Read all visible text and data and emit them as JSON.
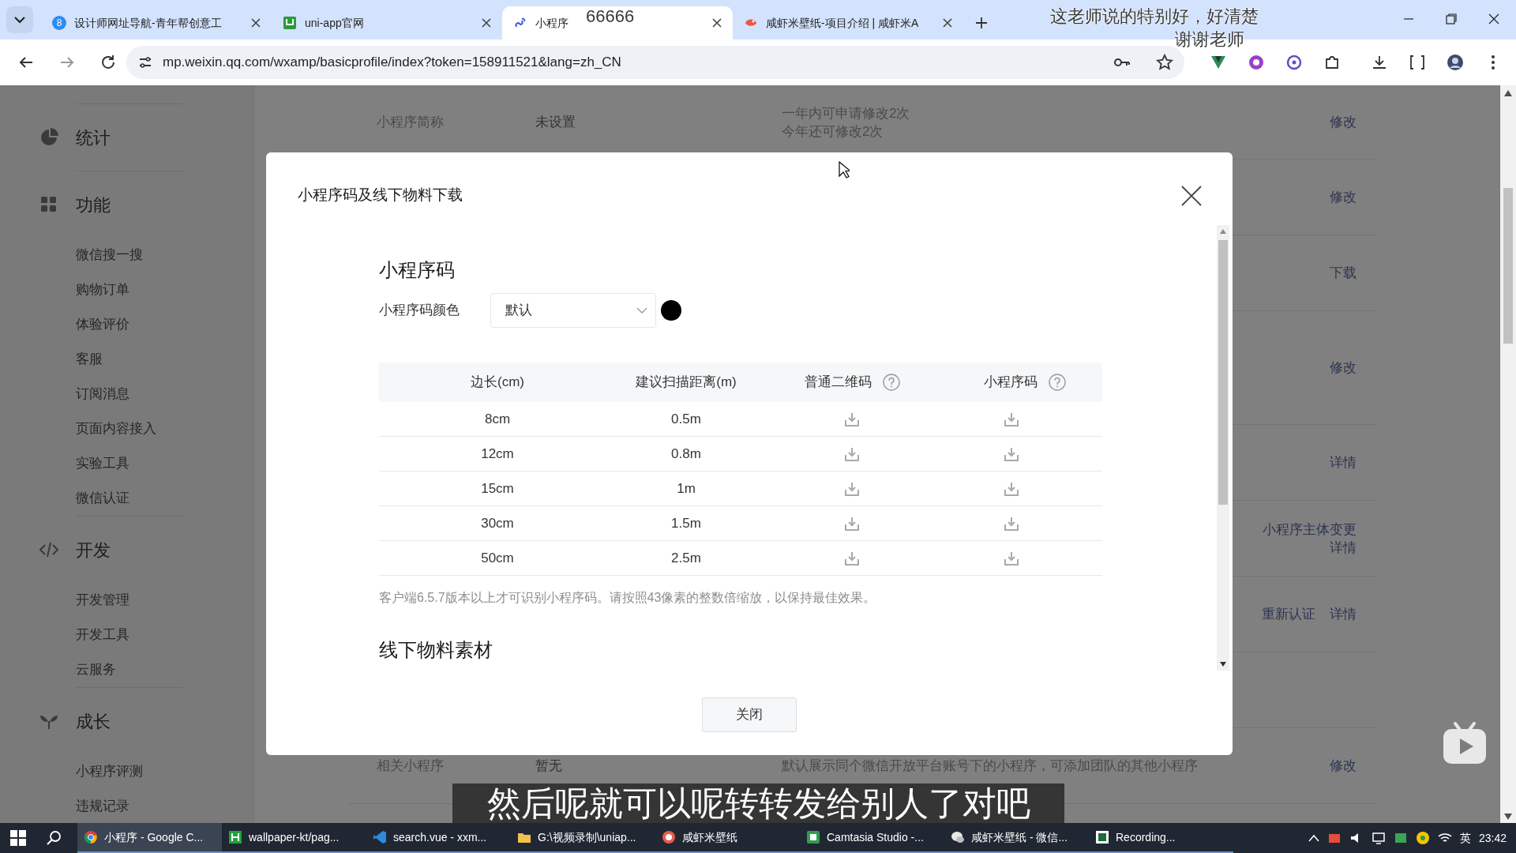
{
  "browser": {
    "tabs": [
      {
        "title": "设计师网址导航-青年帮创意工",
        "icon_text": "8",
        "selected": false
      },
      {
        "title": "uni-app官网",
        "selected": false
      },
      {
        "title": "小程序",
        "selected": true
      },
      {
        "title": "咸虾米壁纸-项目介绍 | 咸虾米A",
        "selected": false
      }
    ],
    "url": "mp.weixin.qq.com/wxamp/basicprofile/index?token=158911521&lang=zh_CN"
  },
  "danmaku": [
    {
      "text": "66666"
    },
    {
      "text": "这老师说的特别好，好清楚"
    },
    {
      "text": "谢谢老师"
    }
  ],
  "sidebar": {
    "sections": [
      {
        "title": "统计"
      },
      {
        "title": "功能",
        "items": [
          {
            "label": "微信搜一搜"
          },
          {
            "label": "购物订单"
          },
          {
            "label": "体验评价"
          },
          {
            "label": "客服"
          },
          {
            "label": "订阅消息"
          },
          {
            "label": "页面内容接入"
          },
          {
            "label": "实验工具"
          },
          {
            "label": "微信认证"
          }
        ]
      },
      {
        "title": "开发",
        "items": [
          {
            "label": "开发管理"
          },
          {
            "label": "开发工具"
          },
          {
            "label": "云服务"
          }
        ]
      },
      {
        "title": "成长",
        "items": [
          {
            "label": "小程序评测"
          },
          {
            "label": "违规记录"
          }
        ]
      }
    ]
  },
  "settings_rows": [
    {
      "label": "小程序简称",
      "value": "未设置",
      "description": [
        "一年内可申请修改2次",
        "今年还可修改2次"
      ],
      "actions": [
        [
          "修改"
        ]
      ]
    },
    {
      "actions": [
        [
          "修改"
        ]
      ]
    },
    {
      "actions": [
        [
          "下载"
        ]
      ]
    },
    {
      "actions": [
        [
          "修改"
        ]
      ]
    },
    {
      "actions": [
        [
          "详情"
        ]
      ]
    },
    {
      "actions": [
        [
          "小程序主体变更"
        ],
        [
          "详情"
        ]
      ]
    },
    {
      "actions": [
        [
          "重新认证",
          "详情"
        ]
      ]
    },
    {},
    {
      "label": "相关小程序",
      "value": "暂无",
      "description": [
        "默认展示同个微信开放平台账号下的小程序，可添加团队的其他小程序"
      ],
      "actions": [
        [
          "修改"
        ]
      ]
    }
  ],
  "dialog": {
    "title": "小程序码及线下物料下载",
    "section_title": "小程序码",
    "color_label": "小程序码颜色",
    "color_select": {
      "value": "默认"
    },
    "table": {
      "columns": [
        {
          "label": "边长(cm)",
          "help": false
        },
        {
          "label": "建议扫描距离(m)",
          "help": false
        },
        {
          "label": "普通二维码",
          "help": true
        },
        {
          "label": "小程序码",
          "help": true
        }
      ],
      "rows": [
        {
          "size": "8cm",
          "distance": "0.5m"
        },
        {
          "size": "12cm",
          "distance": "0.8m"
        },
        {
          "size": "15cm",
          "distance": "1m"
        },
        {
          "size": "30cm",
          "distance": "1.5m"
        },
        {
          "size": "50cm",
          "distance": "2.5m"
        }
      ]
    },
    "note": "客户端6.5.7版本以上才可识别小程序码。请按照43像素的整数倍缩放，以保持最佳效果。",
    "section2_title": "线下物料素材",
    "close_button": "关闭"
  },
  "subtitle": "然后呢就可以呢转转发给别人了对吧",
  "taskbar": {
    "items": [
      {
        "label": "小程序 - Google C...",
        "selected": true
      },
      {
        "label": "wallpaper-kt/pag...",
        "selected": false
      },
      {
        "label": "search.vue - xxm...",
        "selected": false
      },
      {
        "label": "G:\\视频录制\\uniap...",
        "selected": false
      },
      {
        "label": "咸虾米壁纸",
        "selected": false
      },
      {
        "label": "Camtasia Studio -...",
        "selected": false
      },
      {
        "label": "咸虾米壁纸 - 微信...",
        "selected": false
      },
      {
        "label": "Recording...",
        "selected": false
      }
    ],
    "input_language": "英",
    "time": "23:42"
  }
}
